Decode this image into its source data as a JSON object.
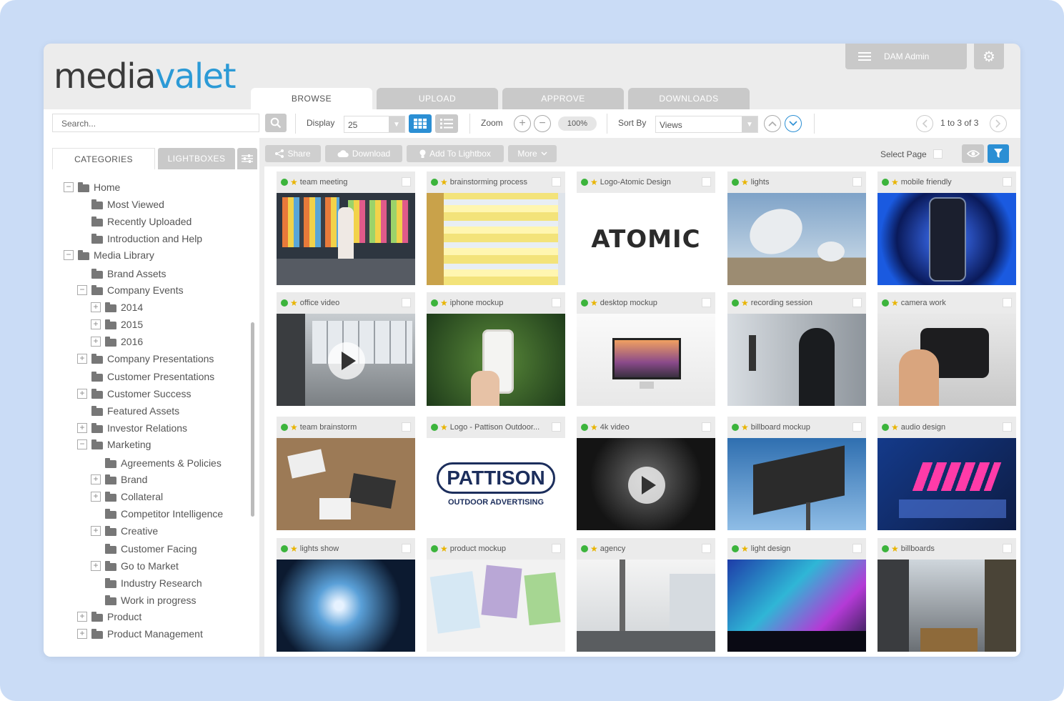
{
  "app": {
    "logo_part1": "media",
    "logo_part2": "valet"
  },
  "header": {
    "admin_label": "DAM Admin"
  },
  "tabs": [
    {
      "label": "BROWSE",
      "active": true
    },
    {
      "label": "UPLOAD",
      "active": false
    },
    {
      "label": "APPROVE",
      "active": false
    },
    {
      "label": "DOWNLOADS",
      "active": false
    }
  ],
  "toolbar": {
    "search_placeholder": "Search...",
    "display_label": "Display",
    "display_value": "25",
    "zoom_label": "Zoom",
    "zoom_in": "+",
    "zoom_out": "−",
    "zoom_value": "100%",
    "sort_label": "Sort By",
    "sort_value": "Views",
    "pagination": "1 to 3 of 3",
    "accent_color": "#2b8fd4"
  },
  "sidebar": {
    "tab_categories": "CATEGORIES",
    "tab_lightboxes": "LIGHTBOXES",
    "tree": [
      {
        "label": "Home",
        "level": 0,
        "expander": "−"
      },
      {
        "label": "Most Viewed",
        "level": 1,
        "expander": ""
      },
      {
        "label": "Recently Uploaded",
        "level": 1,
        "expander": ""
      },
      {
        "label": "Introduction and Help",
        "level": 1,
        "expander": ""
      },
      {
        "label": "Media Library",
        "level": 0,
        "expander": "−"
      },
      {
        "label": "Brand Assets",
        "level": 1,
        "expander": ""
      },
      {
        "label": "Company Events",
        "level": 1,
        "expander": "−"
      },
      {
        "label": "2014",
        "level": 2,
        "expander": "+"
      },
      {
        "label": "2015",
        "level": 2,
        "expander": "+"
      },
      {
        "label": "2016",
        "level": 2,
        "expander": "+"
      },
      {
        "label": "Company Presentations",
        "level": 1,
        "expander": "+"
      },
      {
        "label": "Customer Presentations",
        "level": 1,
        "expander": ""
      },
      {
        "label": "Customer Success",
        "level": 1,
        "expander": "+"
      },
      {
        "label": "Featured Assets",
        "level": 1,
        "expander": ""
      },
      {
        "label": "Investor Relations",
        "level": 1,
        "expander": "+"
      },
      {
        "label": "Marketing",
        "level": 1,
        "expander": "−"
      },
      {
        "label": "Agreements & Policies",
        "level": 2,
        "expander": ""
      },
      {
        "label": "Brand",
        "level": 2,
        "expander": "+"
      },
      {
        "label": "Collateral",
        "level": 2,
        "expander": "+"
      },
      {
        "label": "Competitor Intelligence",
        "level": 2,
        "expander": ""
      },
      {
        "label": "Creative",
        "level": 2,
        "expander": "+"
      },
      {
        "label": "Customer Facing",
        "level": 2,
        "expander": ""
      },
      {
        "label": "Go to Market",
        "level": 2,
        "expander": "+"
      },
      {
        "label": "Industry Research",
        "level": 2,
        "expander": ""
      },
      {
        "label": "Work in progress",
        "level": 2,
        "expander": ""
      },
      {
        "label": "Product",
        "level": 1,
        "expander": "+"
      },
      {
        "label": "Product Management",
        "level": 1,
        "expander": "+"
      }
    ]
  },
  "actions": {
    "share": "Share",
    "download": "Download",
    "add_lightbox": "Add To Lightbox",
    "more": "More",
    "select_page": "Select Page"
  },
  "logos": {
    "atomic": "ATOMIC",
    "pattison": "PATTISON",
    "pattison_sub": "OUTDOOR ADVERTISING"
  },
  "assets": [
    {
      "title": "team meeting",
      "thumb": "meeting",
      "video": false
    },
    {
      "title": "brainstorming process",
      "thumb": "board",
      "video": false
    },
    {
      "title": "Logo-Atomic Design",
      "thumb": "atomic",
      "video": false
    },
    {
      "title": "lights",
      "thumb": "dish",
      "video": false
    },
    {
      "title": "mobile friendly",
      "thumb": "phone-blue",
      "video": false
    },
    {
      "title": "office video",
      "thumb": "office",
      "video": true
    },
    {
      "title": "iphone mockup",
      "thumb": "iphone",
      "video": false
    },
    {
      "title": "desktop mockup",
      "thumb": "imac",
      "video": false
    },
    {
      "title": "recording session",
      "thumb": "recording",
      "video": false
    },
    {
      "title": "camera work",
      "thumb": "camera",
      "video": false
    },
    {
      "title": "team brainstorm",
      "thumb": "desk",
      "video": false
    },
    {
      "title": "Logo - Pattison Outdoor...",
      "thumb": "pattison",
      "video": false
    },
    {
      "title": "4k video",
      "thumb": "dark",
      "video": true
    },
    {
      "title": "billboard mockup",
      "thumb": "billboard",
      "video": false
    },
    {
      "title": "audio design",
      "thumb": "audio",
      "video": false
    },
    {
      "title": "lights show",
      "thumb": "lightshow",
      "video": false
    },
    {
      "title": "product mockup",
      "thumb": "sketch",
      "video": false
    },
    {
      "title": "agency",
      "thumb": "agency",
      "video": false
    },
    {
      "title": "light design",
      "thumb": "concert",
      "video": false
    },
    {
      "title": "billboards",
      "thumb": "city",
      "video": false
    }
  ]
}
